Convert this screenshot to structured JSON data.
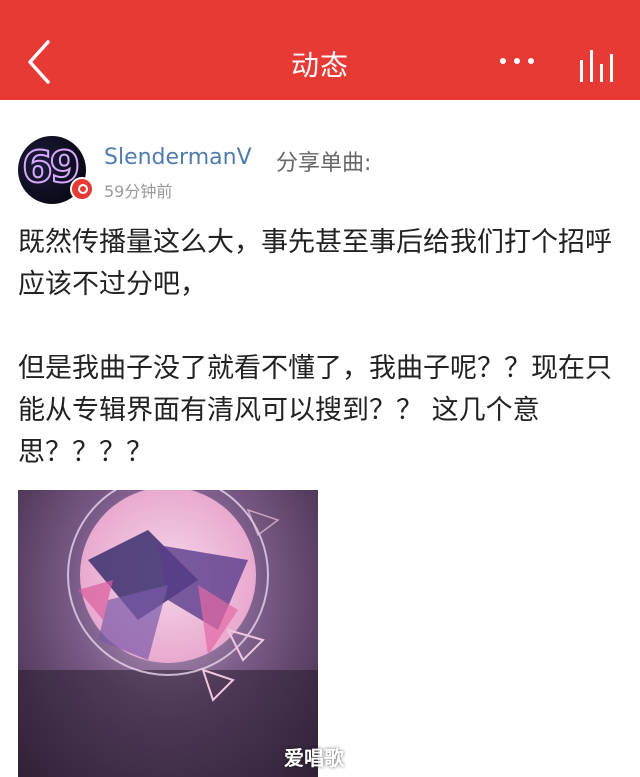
{
  "header": {
    "title": "动态",
    "back_icon": "chevron-left-icon",
    "more_icon": "more-dots-icon",
    "bars_icon": "audio-bars-icon",
    "color": "#e83a35"
  },
  "post": {
    "username": "SlendermanV",
    "action": "分享单曲:",
    "time": "59分钟前",
    "avatar_text": "69",
    "paragraphs": [
      "既然传播量这么大，事先甚至事后给我们打个招呼应该不过分吧，",
      "但是我曲子没了就看不懂了，我曲子呢？？现在只能从专辑界面有清风可以搜到？？  这几个意思？？？？"
    ]
  },
  "watermark": "爱唱歌",
  "colors": {
    "username": "#4f7cac",
    "text": "#222222",
    "meta": "#999999"
  }
}
